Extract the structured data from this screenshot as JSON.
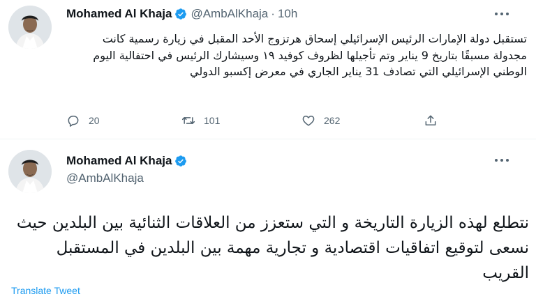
{
  "tweet1": {
    "author_name": "Mohamed Al Khaja",
    "handle": "@AmbAlKhaja",
    "separator": "·",
    "time": "10h",
    "text": "تستقبل دولة الإمارات الرئيس الإسرائيلي إسحاق هرتزوج الأحد المقبل في زيارة رسمية كانت مجدولة مسبقًا بتاريخ 9 يناير وتم تأجيلها لظروف كوفيد ١٩ وسيشارك الرئيس في احتفالية اليوم الوطني الإسرائيلي التي تصادف 31 يناير الجاري في معرض إكسبو الدولي",
    "replies": "20",
    "retweets": "101",
    "likes": "262"
  },
  "tweet2": {
    "author_name": "Mohamed Al Khaja",
    "handle": "@AmbAlKhaja",
    "text": "نتطلع لهذه الزيارة التاريخة و التي ستعزز من العلاقات الثنائية بين البلدين حيث نسعى لتوقيع اتفاقيات اقتصادية و تجارية مهمة بين البلدين في المستقبل القريب",
    "translate_label": "Translate Tweet"
  },
  "icons": {
    "verified": "verified-badge-icon",
    "more": "more-horizontal-icon",
    "reply": "reply-icon",
    "retweet": "retweet-icon",
    "like": "heart-icon",
    "share": "share-icon"
  },
  "colors": {
    "accent": "#1d9bf0",
    "secondary_text": "#536471",
    "divider": "#eff3f4"
  }
}
